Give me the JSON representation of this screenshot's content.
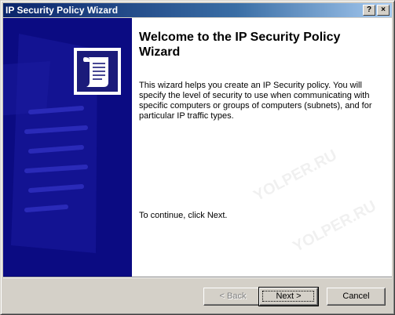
{
  "window": {
    "title": "IP Security Policy Wizard",
    "help_glyph": "?",
    "close_glyph": "×"
  },
  "main": {
    "heading": "Welcome to the IP Security Policy Wizard",
    "description": "This wizard helps you create an IP Security policy. You will specify the level of security to use when communicating with specific computers or groups of computers (subnets), and for particular IP traffic types.",
    "continue_text": "To continue, click Next."
  },
  "buttons": {
    "back": "< Back",
    "next": "Next >",
    "cancel": "Cancel"
  },
  "watermark": "YOLPER.RU",
  "colors": {
    "banner": "#0b0b82",
    "titlebar_start": "#0a246a",
    "titlebar_end": "#a6caf0",
    "dialog": "#d4d0c8"
  },
  "icons": {
    "banner_logo": "scroll-document-icon"
  }
}
